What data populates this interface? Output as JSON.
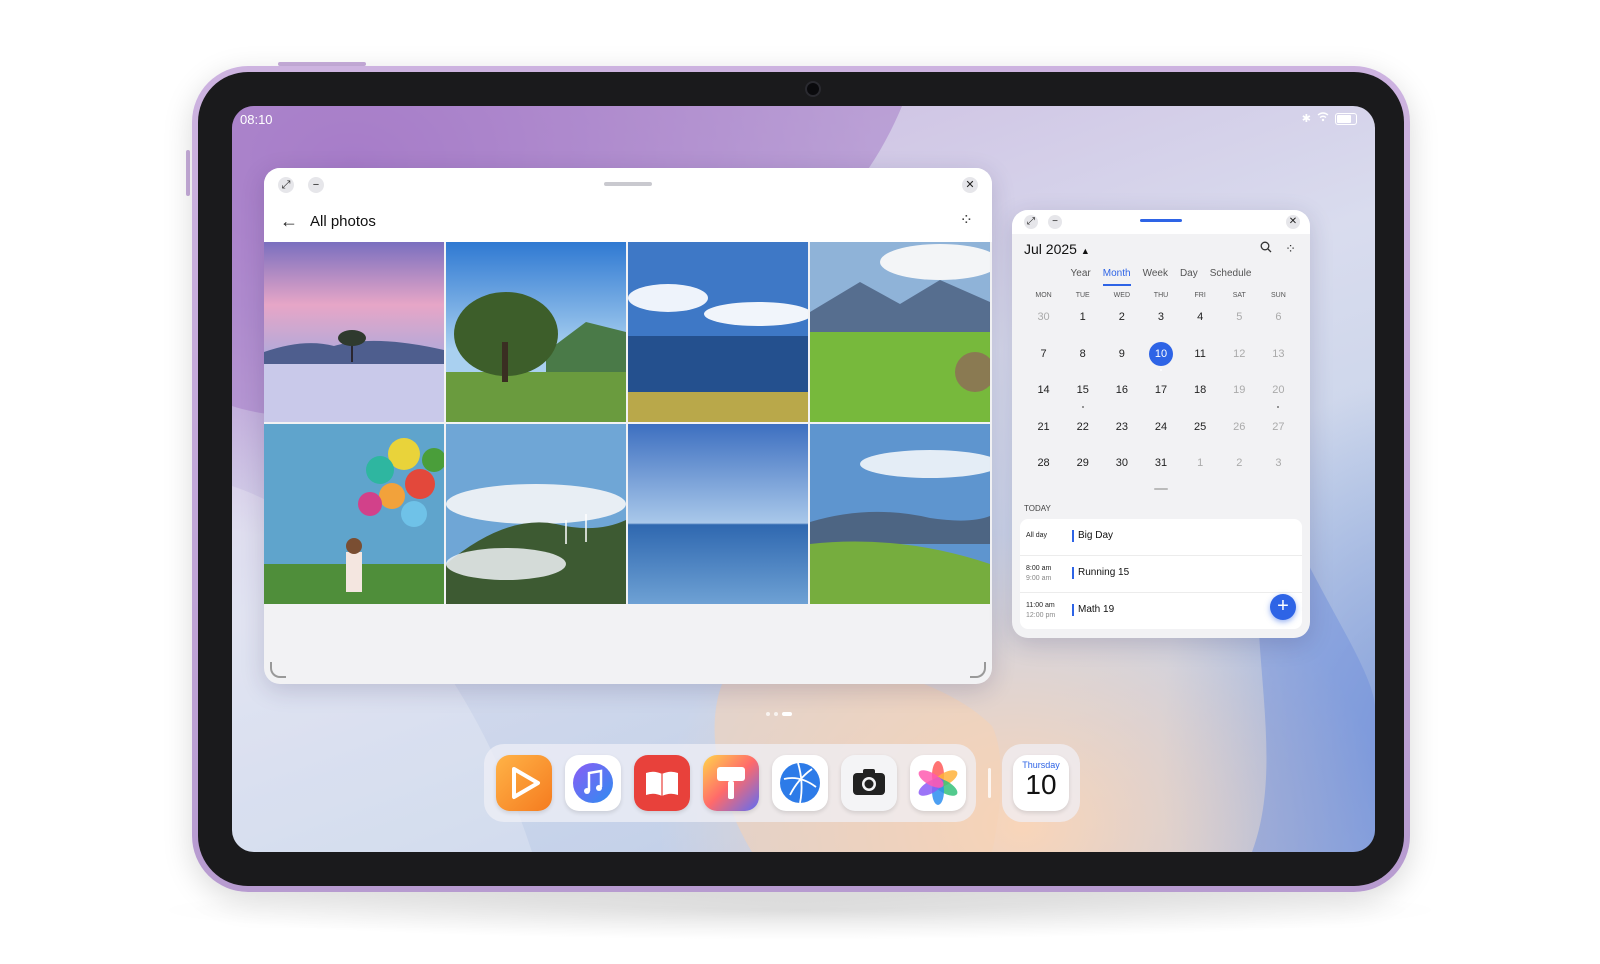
{
  "status_bar": {
    "time": "08:10"
  },
  "photos_window": {
    "title": "All photos",
    "photos": [
      "lake-tree-sunset",
      "oak-tree-field",
      "coast-sea",
      "green-hills-hay",
      "girl-balloons",
      "windmill-mountains",
      "ocean-sky",
      "green-slopes"
    ]
  },
  "calendar_window": {
    "month_label": "Jul 2025",
    "views": [
      {
        "label": "Year"
      },
      {
        "label": "Month",
        "active": true
      },
      {
        "label": "Week"
      },
      {
        "label": "Day"
      },
      {
        "label": "Schedule"
      }
    ],
    "weekdays": [
      "MON",
      "TUE",
      "WED",
      "THU",
      "FRI",
      "SAT",
      "SUN"
    ],
    "days": [
      {
        "n": "30",
        "muted": true
      },
      {
        "n": "1"
      },
      {
        "n": "2"
      },
      {
        "n": "3"
      },
      {
        "n": "4"
      },
      {
        "n": "5",
        "muted": true
      },
      {
        "n": "6",
        "muted": true
      },
      {
        "n": "7"
      },
      {
        "n": "8"
      },
      {
        "n": "9"
      },
      {
        "n": "10",
        "today": true,
        "dot": true
      },
      {
        "n": "11"
      },
      {
        "n": "12",
        "muted": true
      },
      {
        "n": "13",
        "muted": true
      },
      {
        "n": "14"
      },
      {
        "n": "15",
        "dot": true
      },
      {
        "n": "16"
      },
      {
        "n": "17"
      },
      {
        "n": "18"
      },
      {
        "n": "19",
        "muted": true
      },
      {
        "n": "20",
        "muted": true,
        "dot": true
      },
      {
        "n": "21"
      },
      {
        "n": "22"
      },
      {
        "n": "23"
      },
      {
        "n": "24"
      },
      {
        "n": "25"
      },
      {
        "n": "26",
        "muted": true
      },
      {
        "n": "27",
        "muted": true
      },
      {
        "n": "28"
      },
      {
        "n": "29"
      },
      {
        "n": "30"
      },
      {
        "n": "31"
      },
      {
        "n": "1",
        "muted": true
      },
      {
        "n": "2",
        "muted": true
      },
      {
        "n": "3",
        "muted": true
      }
    ],
    "today_label": "TODAY",
    "events": [
      {
        "time1": "All day",
        "time2": "",
        "name": "Big Day"
      },
      {
        "time1": "8:00 am",
        "time2": "9:00 am",
        "name": "Running 15"
      },
      {
        "time1": "11:00 am",
        "time2": "12:00 pm",
        "name": "Math 19"
      }
    ]
  },
  "dock": {
    "apps": [
      "video-app",
      "music-app",
      "books-app",
      "themes-app",
      "browser-app",
      "camera-app",
      "photos-app"
    ],
    "calendar_widget": {
      "weekday": "Thursday",
      "day": "10"
    }
  },
  "colors": {
    "accent": "#2e64e6",
    "frame": "#c7addb"
  }
}
